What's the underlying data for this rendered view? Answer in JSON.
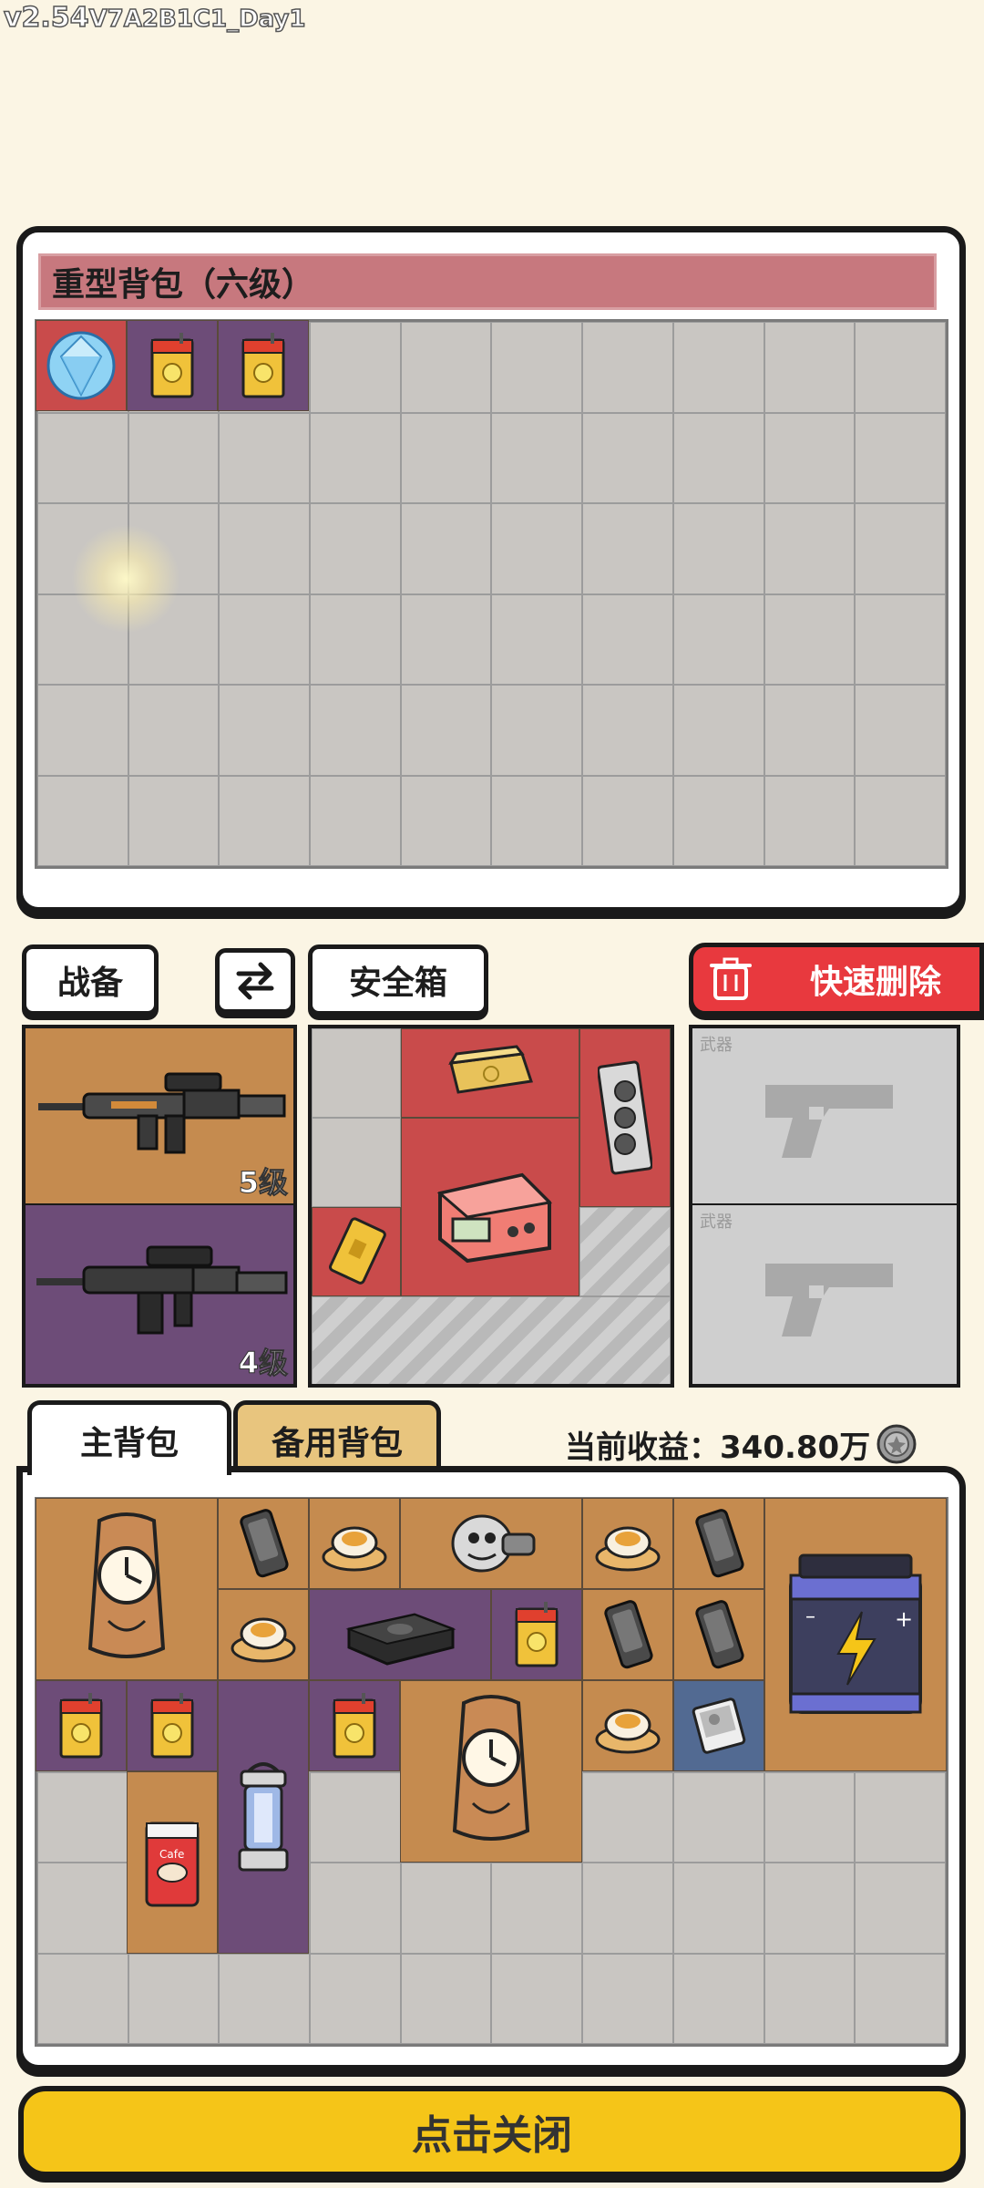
{
  "version": {
    "prefix": "v2.54",
    "build": "V7A2B1C1_Day1"
  },
  "top_pack": {
    "title": "重型背包（六级）"
  },
  "buttons": {
    "gear": "战备",
    "safe_box": "安全箱",
    "quick_delete": "快速删除",
    "close": "点击关闭"
  },
  "gear_slots": [
    {
      "level": "5级"
    },
    {
      "level": "4级"
    }
  ],
  "weapon_slots": [
    {
      "label": "武器"
    },
    {
      "label": "武器"
    }
  ],
  "tabs": {
    "main": "主背包",
    "backup": "备用背包"
  },
  "earnings": {
    "label": "当前收益：",
    "value": "340.80万"
  },
  "colors": {
    "background": "#fbf5e4",
    "accent_red": "#e8393e",
    "close_yellow": "#f5c518",
    "tier_red": "#c94b4b",
    "tier_purple": "#6d4c78",
    "tier_orange": "#c58b4f",
    "tier_blue": "#526a92"
  },
  "icons": [
    "diamond-icon",
    "juice-box-icon",
    "rifle-icon",
    "gold-bar-icon",
    "gpu-card-icon",
    "pink-machine-icon",
    "gold-card-icon",
    "pistol-icon",
    "clock-icon",
    "phone-icon",
    "pudding-icon",
    "figurine-icon",
    "router-icon",
    "battery-icon",
    "lantern-icon",
    "coffee-can-icon",
    "photo-icon",
    "trash-icon",
    "swap-icon",
    "coin-icon"
  ]
}
